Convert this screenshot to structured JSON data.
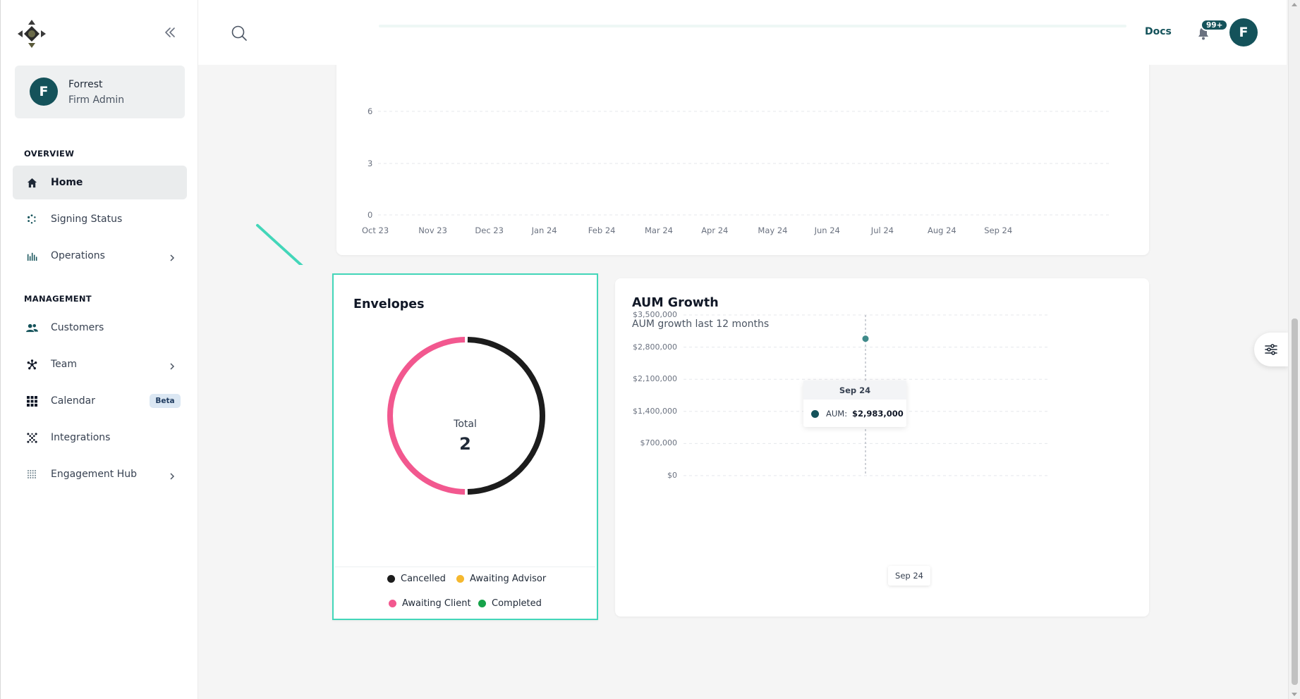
{
  "brand": {
    "logo_icon": "compass-logo-icon"
  },
  "sidebar": {
    "collapse_icon": "double-chevron-left-icon",
    "user": {
      "initial": "F",
      "name": "Forrest",
      "role": "Firm Admin"
    },
    "sections": [
      {
        "label": "OVERVIEW"
      },
      {
        "label": "MANAGEMENT"
      }
    ],
    "items": [
      {
        "label": "Home",
        "icon": "home-icon",
        "active": true
      },
      {
        "label": "Signing Status",
        "icon": "spinner-icon"
      },
      {
        "label": "Operations",
        "icon": "bar-chart-icon",
        "expandable": true
      },
      {
        "label": "Customers",
        "icon": "users-icon"
      },
      {
        "label": "Team",
        "icon": "asterisk-icon",
        "expandable": true
      },
      {
        "label": "Calendar",
        "icon": "grid-icon",
        "badge": "Beta"
      },
      {
        "label": "Integrations",
        "icon": "dots-pattern-icon"
      },
      {
        "label": "Engagement Hub",
        "icon": "dot-grid-icon",
        "expandable": true
      }
    ]
  },
  "topbar": {
    "search_icon": "search-icon",
    "docs_label": "Docs",
    "notification_count": "99+",
    "avatar_initial": "F"
  },
  "colors": {
    "brand": "#14525a",
    "cancelled": "#1c1c1c",
    "awaiting_advisor": "#f5b82e",
    "awaiting_client": "#f2588f",
    "completed": "#16a34a",
    "highlight": "#43d6b9"
  },
  "top_chart": {
    "y_ticks": [
      "0",
      "3",
      "6"
    ],
    "x_ticks": [
      "Oct 23",
      "Nov 23",
      "Dec 23",
      "Jan 24",
      "Feb 24",
      "Mar 24",
      "Apr 24",
      "May 24",
      "Jun 24",
      "Jul 24",
      "Aug 24",
      "Sep 24"
    ]
  },
  "envelopes": {
    "title": "Envelopes",
    "center_label": "Total",
    "total": "2",
    "legend": [
      {
        "label": "Cancelled",
        "color": "#1c1c1c"
      },
      {
        "label": "Awaiting Advisor",
        "color": "#f5b82e"
      },
      {
        "label": "Awaiting Client",
        "color": "#f2588f"
      },
      {
        "label": "Completed",
        "color": "#16a34a"
      }
    ]
  },
  "aum": {
    "title": "AUM Growth",
    "subtitle": "AUM growth last 12 months",
    "y_ticks": [
      "$3,500,000",
      "$2,800,000",
      "$2,100,000",
      "$1,400,000",
      "$700,000",
      "$0"
    ],
    "tooltip": {
      "header": "Sep 24",
      "label": "AUM:",
      "value": "$2,983,000"
    },
    "x_tooltip": "Sep 24"
  },
  "chart_data": [
    {
      "type": "pie",
      "title": "Envelopes",
      "categories": [
        "Cancelled",
        "Awaiting Advisor",
        "Awaiting Client",
        "Completed"
      ],
      "values": [
        1,
        0,
        1,
        0
      ],
      "total": 2
    },
    {
      "type": "line",
      "title": "AUM Growth",
      "subtitle": "AUM growth last 12 months",
      "x": [
        "Sep 24"
      ],
      "series": [
        {
          "name": "AUM",
          "values": [
            2983000
          ]
        }
      ],
      "ylim": [
        0,
        3500000
      ],
      "grid": true
    }
  ]
}
